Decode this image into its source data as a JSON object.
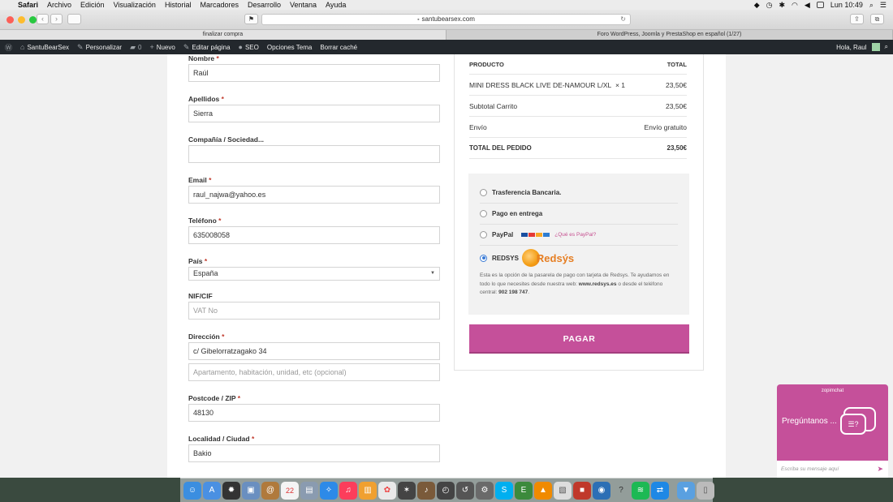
{
  "menubar": {
    "items": [
      "Safari",
      "Archivo",
      "Edición",
      "Visualización",
      "Historial",
      "Marcadores",
      "Desarrollo",
      "Ventana",
      "Ayuda"
    ],
    "clock": "Lun 10:49"
  },
  "browser": {
    "url": "santubearsex.com",
    "tabs": [
      "finalizar compra",
      "Foro WordPress, Joomla y PrestaShop en español (1/27)"
    ]
  },
  "adminbar": {
    "site": "SantuBearSex",
    "customize": "Personalizar",
    "comments": "0",
    "new": "Nuevo",
    "edit": "Editar página",
    "seo": "SEO",
    "theme_options": "Opciones Tema",
    "clear_cache": "Borrar caché",
    "greeting": "Hola, Raul"
  },
  "form": {
    "nombre": {
      "label": "Nombre",
      "value": "Raúl"
    },
    "apellidos": {
      "label": "Apellidos",
      "value": "Sierra"
    },
    "compania": {
      "label": "Compañía / Sociedad...",
      "value": ""
    },
    "email": {
      "label": "Email",
      "value": "raul_najwa@yahoo.es"
    },
    "telefono": {
      "label": "Teléfono",
      "value": "635008058"
    },
    "pais": {
      "label": "País",
      "value": "España"
    },
    "nif": {
      "label": "NIF/CIF",
      "placeholder": "VAT No"
    },
    "direccion": {
      "label": "Dirección",
      "value": "c/ Gibelorratzagako 34",
      "placeholder2": "Apartamento, habitación, unidad, etc (opcional)"
    },
    "postcode": {
      "label": "Postcode / ZIP",
      "value": "48130"
    },
    "localidad": {
      "label": "Localidad / Ciudad",
      "value": "Bakio"
    },
    "required_mark": "*"
  },
  "order": {
    "header_product": "PRODUCTO",
    "header_total": "TOTAL",
    "item_name": "MINI DRESS BLACK LIVE DE-NAMOUR L/XL",
    "item_qty": "× 1",
    "item_total": "23,50€",
    "subtotal_label": "Subtotal Carrito",
    "subtotal_value": "23,50€",
    "shipping_label": "Envío",
    "shipping_value": "Envío gratuito",
    "total_label": "TOTAL DEL PEDIDO",
    "total_value": "23,50€"
  },
  "payment": {
    "methods": [
      {
        "label": "Trasferencia Bancaria.",
        "selected": false
      },
      {
        "label": "Pago en entrega",
        "selected": false
      },
      {
        "label": "PayPal",
        "selected": false,
        "link": "¿Qué es PayPal?"
      },
      {
        "label": "REDSYS",
        "selected": true
      }
    ],
    "redsys_logo_text": "Redsýs",
    "desc_1": "Esta es la opción de la pasarela de pago con tarjeta de Redsys. Te ayudamos en todo lo que necesites desde nuestra web: ",
    "desc_web": "www.redsys.es",
    "desc_2": " o desde el teléfono central: ",
    "desc_phone": "902 198 747",
    "desc_3": ".",
    "pay_button": "PAGAR"
  },
  "chat": {
    "brand": "zopimchat",
    "question": "Pregúntanos ...",
    "placeholder": "Escriba su mensaje aquí"
  },
  "dock": {
    "calendar_day": "22"
  }
}
